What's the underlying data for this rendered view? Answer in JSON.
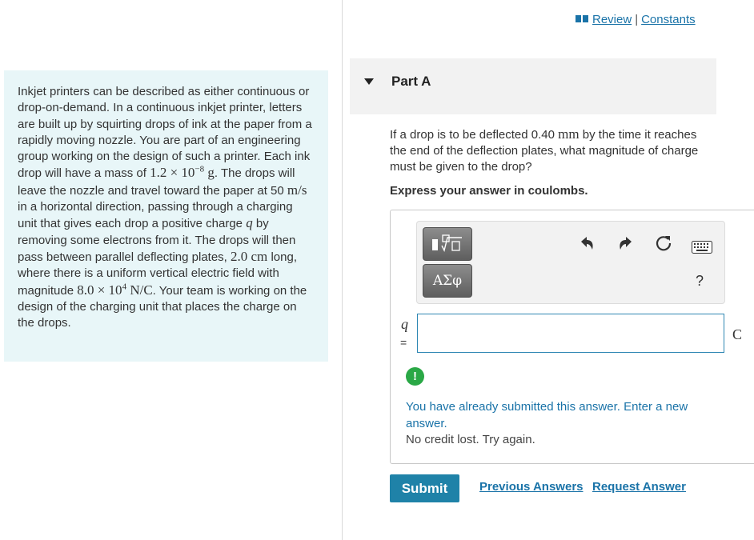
{
  "problem": {
    "line1": "Inkjet printers can be described as either continuous or drop-on-demand. In a continuous inkjet printer, letters are built up by squirting drops of ink at the paper from a rapidly moving nozzle. You are part of an engineering group working on the design of such a printer. Each ink drop will have a mass of ",
    "mass_value": "1.2 × 10",
    "mass_exp": "−8",
    "mass_unit": " g",
    "line2": ". The drops will leave the nozzle and travel toward the paper at 50 ",
    "speed_unit": "m/s",
    "line3": " in a horizontal direction, passing through a charging unit that gives each drop a positive charge ",
    "charge_symbol": "q",
    "line4": " by removing some electrons from it. The drops will then pass between parallel deflecting plates, ",
    "length_value": "2.0 cm",
    "line5": " long, where there is a uniform vertical electric field with magnitude ",
    "field_value": "8.0 × 10",
    "field_exp": "4",
    "field_unit": " N/C",
    "line6": ". Your team is working on the design of the charging unit that places the charge on the drops."
  },
  "header": {
    "review_label": "Review",
    "separator": "|",
    "constants_label": "Constants"
  },
  "part": {
    "title": "Part A",
    "question_pre": "If a drop is to be deflected 0.40 ",
    "question_unit": "mm",
    "question_post": " by the time it reaches the end of the deflection plates, what magnitude of charge must be given to the drop?",
    "instruction": "Express your answer in coulombs."
  },
  "toolbar": {
    "symbols_label": "ΑΣφ",
    "help_label": "?"
  },
  "answer": {
    "variable": "q",
    "equals": "=",
    "value": "",
    "unit": "C"
  },
  "feedback": {
    "alert_symbol": "!",
    "message": "You have already submitted this answer. Enter a new answer.",
    "sub_message": "No credit lost. Try again."
  },
  "actions": {
    "submit_label": "Submit",
    "previous_answers_label": "Previous Answers",
    "request_answer_label": "Request Answer"
  }
}
